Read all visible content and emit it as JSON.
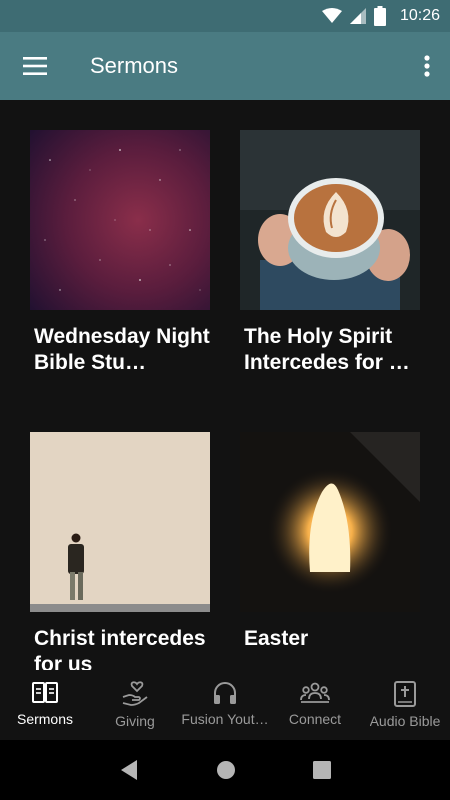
{
  "status_bar": {
    "time": "10:26",
    "icons": [
      "wifi-icon",
      "signal-icon",
      "battery-icon"
    ]
  },
  "app_bar": {
    "title": "Sermons",
    "menu_icon": "hamburger-menu-icon",
    "overflow_icon": "more-vert-icon"
  },
  "sermons": [
    {
      "title": "Wednesday Night Bible Stu…",
      "image": "starry-night-sky"
    },
    {
      "title": "The Holy Spirit Intercedes for …",
      "image": "coffee-latte-in-hands"
    },
    {
      "title": "Christ intercedes for us",
      "image": "man-walking-by-wall"
    },
    {
      "title": "Easter",
      "image": "empty-tomb-cave-light"
    }
  ],
  "bottom_nav": {
    "items": [
      {
        "label": "Sermons",
        "icon": "book-open-icon",
        "active": true
      },
      {
        "label": "Giving",
        "icon": "hand-heart-icon",
        "active": false
      },
      {
        "label": "Fusion Yout…",
        "icon": "headphones-icon",
        "active": false
      },
      {
        "label": "Connect",
        "icon": "people-group-icon",
        "active": false
      },
      {
        "label": "Audio Bible",
        "icon": "bible-cross-icon",
        "active": false
      }
    ]
  },
  "system_nav": [
    "back-icon",
    "home-icon",
    "recents-icon"
  ],
  "colors": {
    "app_bar": "#4a7b82",
    "status_bar": "#3e6c73",
    "background": "#121212",
    "active_tab": "#ffffff",
    "inactive_tab": "#9a9a9a"
  }
}
